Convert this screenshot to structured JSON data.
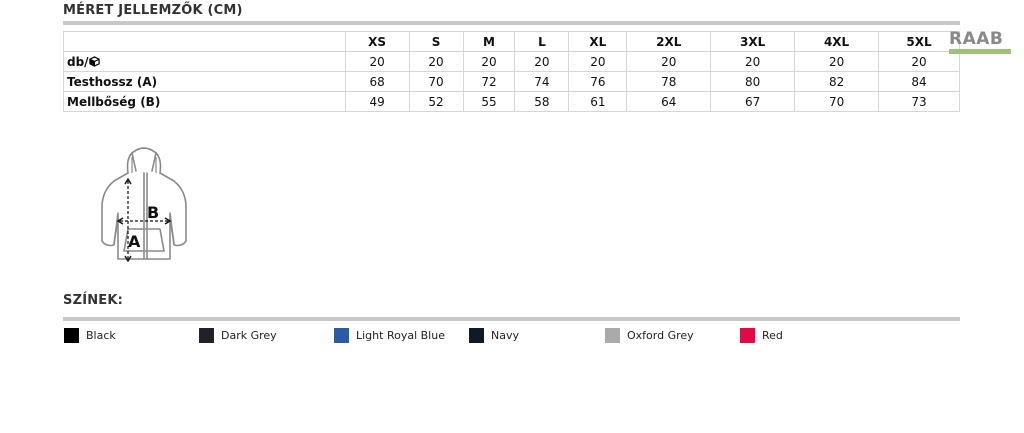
{
  "size_section": {
    "title": "MÉRET JELLEMZŐK (CM)"
  },
  "table": {
    "columns": [
      "",
      "XS",
      "S",
      "M",
      "L",
      "XL",
      "2XL",
      "3XL",
      "4XL",
      "5XL"
    ],
    "rows": [
      {
        "label": "db/",
        "icon": "box-icon",
        "values": [
          "20",
          "20",
          "20",
          "20",
          "20",
          "20",
          "20",
          "20",
          "20"
        ]
      },
      {
        "label": "Testhossz (A)",
        "values": [
          "68",
          "70",
          "72",
          "74",
          "76",
          "78",
          "80",
          "82",
          "84"
        ]
      },
      {
        "label": "Mellbőség (B)",
        "values": [
          "49",
          "52",
          "55",
          "58",
          "61",
          "64",
          "67",
          "70",
          "73"
        ]
      }
    ]
  },
  "logo": {
    "text": "RAAB",
    "bar_color": "#9ec27a"
  },
  "diagram": {
    "label_a": "A",
    "label_b": "B",
    "icon": "hoodie-measurement-icon"
  },
  "colors_section": {
    "title": "SZÍNEK:"
  },
  "swatches": [
    {
      "name": "Black",
      "color": "#000000"
    },
    {
      "name": "Dark Grey",
      "color": "#1f2329"
    },
    {
      "name": "Light Royal Blue",
      "color": "#2e5aa5"
    },
    {
      "name": "Navy",
      "color": "#0c1a2b"
    },
    {
      "name": "Oxford Grey",
      "color": "#aaaaaa"
    },
    {
      "name": "Red",
      "color": "#e00a46"
    }
  ]
}
